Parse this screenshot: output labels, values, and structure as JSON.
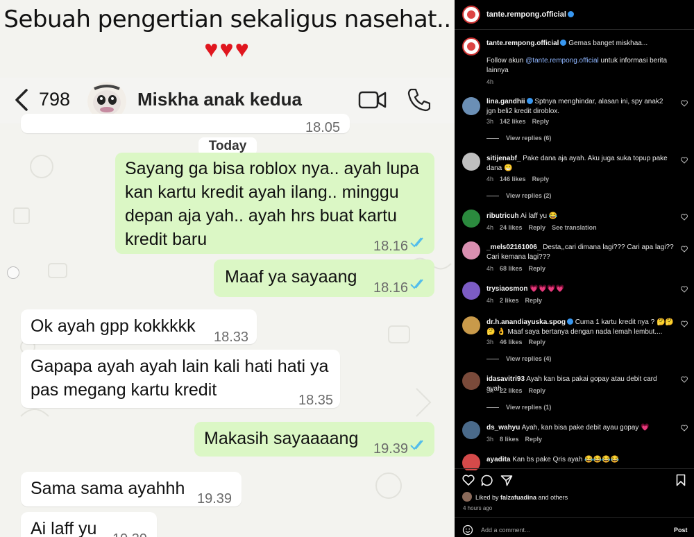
{
  "post": {
    "caption": "Sebuah pengertian sekaligus nasehat..",
    "hearts": "❤️❤️❤️"
  },
  "chat": {
    "unread_count": "798",
    "contact_name": "Miskha anak kedua",
    "partial_top_time": "18.05",
    "date_chip": "Today",
    "messages": [
      {
        "dir": "out",
        "lines": [
          "Sayang ga bisa roblox nya.. ayah lupa",
          "kan kartu kredit ayah ilang.. minggu",
          "depan aja yah.. ayah hrs buat kartu",
          "kredit baru"
        ],
        "time": "18.16"
      },
      {
        "dir": "out",
        "lines": [
          "Maaf ya sayaang"
        ],
        "time": "18.16"
      },
      {
        "dir": "in",
        "lines": [
          "Ok ayah gpp kokkkkk"
        ],
        "time": "18.33"
      },
      {
        "dir": "in",
        "lines": [
          "Gapapa ayah ayah lain kali hati hati ya",
          "pas megang kartu kredit"
        ],
        "time": "18.35"
      },
      {
        "dir": "out",
        "lines": [
          "Makasih sayaaaang"
        ],
        "time": "19.39"
      },
      {
        "dir": "in",
        "lines": [
          "Sama sama ayahhh"
        ],
        "time": "19.39"
      },
      {
        "dir": "in",
        "lines": [
          "Ai laff yu"
        ],
        "time": "19.39"
      }
    ]
  },
  "panel": {
    "author": "tante.rempong.official",
    "caption_text": "Gemas banget miskhaa...",
    "follow_prefix": "Follow akun ",
    "follow_mention": "@tante.rempong.official",
    "follow_suffix": " untuk informasi berita lainnya",
    "caption_age": "4h",
    "comments": [
      {
        "user": "lina.gandhii",
        "verified": true,
        "text": "Sptnya menghindar, alasan ini, spy anak2 jgn beli2 kredit diroblox.",
        "age": "3h",
        "likes": "142 likes",
        "reply": "Reply",
        "replies": "View replies (6)",
        "avatar_color": "#6b8fb5"
      },
      {
        "user": "sitijenabf_",
        "verified": false,
        "text": "Pake dana aja ayah. Aku juga suka topup pake dana 😁",
        "age": "4h",
        "likes": "146 likes",
        "reply": "Reply",
        "replies": "View replies (2)",
        "avatar_color": "#bfbfbf"
      },
      {
        "user": "ributricuh",
        "verified": false,
        "text": "Ai laff yu 😂",
        "age": "4h",
        "likes": "24 likes",
        "reply": "Reply",
        "translate": "See translation",
        "avatar_color": "#2b8a3e"
      },
      {
        "user": "_mels02161006_",
        "verified": false,
        "text": "Desta,,cari dimana lagi??? Cari apa lagi?? Cari kemana lagi???",
        "age": "4h",
        "likes": "68 likes",
        "reply": "Reply",
        "avatar_color": "#d98fb0"
      },
      {
        "user": "trysiaosmon",
        "verified": false,
        "text": "💗💗💗💗",
        "age": "4h",
        "likes": "2 likes",
        "reply": "Reply",
        "avatar_color": "#7c5cc4"
      },
      {
        "user": "dr.h.anandiayuska.spog",
        "verified": true,
        "text": "Cuma 1 kartu kredit nya ? 🤔🤔🤔 👌 Maaf saya bertanya dengan nada lemah lembut....",
        "age": "3h",
        "likes": "46 likes",
        "reply": "Reply",
        "replies": "View replies (4)",
        "avatar_color": "#c99a4a"
      },
      {
        "user": "idasavitri93",
        "verified": false,
        "text": "Ayah kan bisa pakai gopay atau debit card ayah",
        "age": "3h",
        "likes": "22 likes",
        "reply": "Reply",
        "replies": "View replies (1)",
        "avatar_color": "#7a4a3a"
      },
      {
        "user": "ds_wahyu",
        "verified": false,
        "text": "Ayah, kan bisa pake debit ayau gopay 💗",
        "age": "3h",
        "likes": "8 likes",
        "reply": "Reply",
        "avatar_color": "#4a6a8a"
      },
      {
        "user": "ayadita",
        "verified": false,
        "text": "Kan bs pake Qris ayah 😂😂😂😂",
        "avatar_color": "#d44a4a"
      }
    ],
    "liked_by_prefix": "Liked by ",
    "liked_by_user": "falzafuadina",
    "liked_by_suffix": " and others",
    "post_age": "4 hours ago",
    "add_comment_placeholder": "Add a comment...",
    "post_label": "Post"
  },
  "colors": {
    "chat_out_bubble": "#dbf7c5",
    "chat_in_bubble": "#ffffff",
    "read_ticks": "#53bdeb",
    "panel_bg": "#000000",
    "link": "#8fb6ff",
    "verified": "#3897f0",
    "heart_red": "#e0161e"
  }
}
